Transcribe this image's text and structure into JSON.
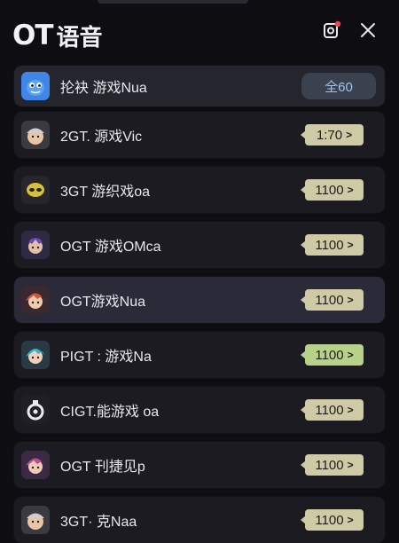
{
  "header": {
    "logo": "OT",
    "title": "语音",
    "notification_icon": "notification-icon",
    "close_icon": "close-icon",
    "notification_dot_color": "#e54b4b"
  },
  "rows": [
    {
      "label": "抡袂 游戏Nua",
      "value": "全60",
      "style": "blue",
      "avatar": "blue-creature-avatar"
    },
    {
      "label": "2GT. 源戏Vic",
      "value": "1:70",
      "style": "cream",
      "avatar": "cap-boy-avatar"
    },
    {
      "label": "3GT 游织戏oa",
      "value": "1100",
      "style": "cream",
      "avatar": "mask-avatar"
    },
    {
      "label": "OGT 游戏OMca",
      "value": "1100",
      "style": "cream",
      "avatar": "purple-hair-avatar"
    },
    {
      "label": "OGT游戏Nua",
      "value": "1100",
      "style": "cream",
      "avatar": "red-hair-avatar"
    },
    {
      "label": "PIGT : 游戏Na",
      "value": "1100",
      "style": "green",
      "avatar": "teal-hair-avatar"
    },
    {
      "label": "CIGT.能游戏 oa",
      "value": "1100",
      "style": "cream",
      "avatar": "stopwatch-avatar"
    },
    {
      "label": "OGT 刊捷见p",
      "value": "1100",
      "style": "cream",
      "avatar": "pink-hair-avatar"
    },
    {
      "label": "3GT· 克Naa",
      "value": "1100",
      "style": "cream",
      "avatar": "cap-boy-avatar-2"
    }
  ],
  "arrow_glyph": ">"
}
